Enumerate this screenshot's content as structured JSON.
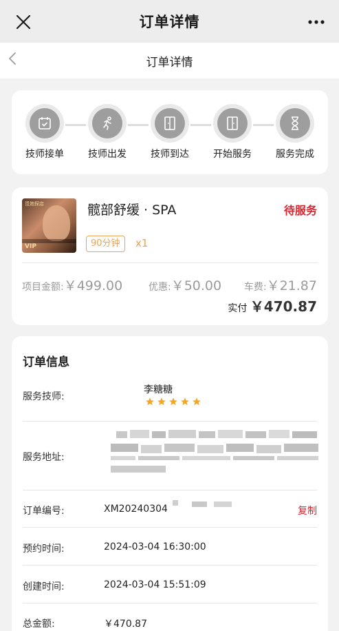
{
  "wechat_bar": {
    "title": "订单详情",
    "close_icon": "close-icon",
    "more_icon": "more-dots-icon"
  },
  "page_header": {
    "title": "订单详情",
    "back_icon": "back-arrow-icon"
  },
  "steps": [
    {
      "label": "技师接单",
      "icon": "calendar-check-icon"
    },
    {
      "label": "技师出发",
      "icon": "running-person-icon"
    },
    {
      "label": "技师到达",
      "icon": "door-icon"
    },
    {
      "label": "开始服务",
      "icon": "door-open-icon"
    },
    {
      "label": "服务完成",
      "icon": "hourglass-icon"
    }
  ],
  "product": {
    "name": "髋部舒缓 · SPA",
    "status": "待服务",
    "duration": "90分钟",
    "quantity": "x1",
    "thumb_tag": "觅她探店",
    "thumb_vip": "VIP",
    "item_amount_label": "项目金额:",
    "item_amount": "￥499.00",
    "discount_label": "优惠:",
    "discount": "￥50.00",
    "fare_label": "车费:",
    "fare": "￥21.87",
    "paid_label": "实付",
    "paid": "￥470.87",
    "status_color": "#d9232d",
    "accent_color": "#e6a55a"
  },
  "order_info": {
    "title": "订单信息",
    "technician_label": "服务技师:",
    "technician_name": "李糖糖",
    "technician_rating": 5,
    "address_label": "服务地址:",
    "order_no_label": "订单编号:",
    "order_no": "XM20240304",
    "copy_label": "复制",
    "appointment_label": "预约时间:",
    "appointment_time": "2024-03-04 16:30:00",
    "created_label": "创建时间:",
    "created_time": "2024-03-04 15:51:09",
    "total_label": "总金额:",
    "total": "￥470.87"
  }
}
